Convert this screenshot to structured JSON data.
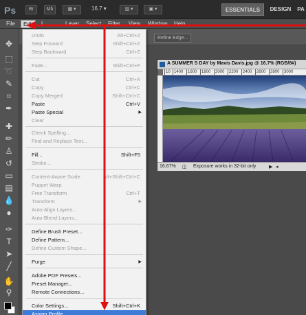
{
  "app": {
    "logo": "Ps",
    "bridge_button": "Br",
    "minibridge_button": "Mb",
    "zoom_level": "16.7",
    "workspaces": [
      "ESSENTIALS",
      "DESIGN",
      "PA"
    ]
  },
  "menubar": {
    "items": [
      "File",
      "Edit",
      "I",
      "Layer",
      "Select",
      "Filter",
      "View",
      "Window",
      "Help"
    ]
  },
  "options": {
    "refine_edge": "Refine Edge..."
  },
  "document": {
    "title": "A SUMMER S DAY by Mavis Davis.jpg @ 16.7% (RGB/8#)",
    "ruler_ticks": [
      "10",
      "1400",
      "1600",
      "1800",
      "2000",
      "2200",
      "2400",
      "2600",
      "2800",
      "3000"
    ],
    "status_zoom": "16.67%",
    "status_text": "Exposure works in 32-bit only"
  },
  "edit_menu": {
    "items": [
      {
        "label": "Undo",
        "shortcut": "Alt+Ctrl+Z",
        "disabled": true
      },
      {
        "label": "Step Forward",
        "shortcut": "Shift+Ctrl+Z",
        "disabled": true
      },
      {
        "label": "Step Backward",
        "shortcut": "Ctrl+Z",
        "disabled": true
      },
      {
        "label": "Fade...",
        "shortcut": "Shift+Ctrl+F",
        "disabled": true
      },
      {
        "label": "Cut",
        "shortcut": "Ctrl+X",
        "disabled": true
      },
      {
        "label": "Copy",
        "shortcut": "Ctrl+C",
        "disabled": true
      },
      {
        "label": "Copy Merged",
        "shortcut": "Shift+Ctrl+C",
        "disabled": true
      },
      {
        "label": "Paste",
        "shortcut": "Ctrl+V",
        "disabled": false
      },
      {
        "label": "Paste Special",
        "shortcut": "",
        "disabled": false,
        "submenu": true
      },
      {
        "label": "Clear",
        "shortcut": "",
        "disabled": true
      },
      {
        "label": "Check Spelling...",
        "shortcut": "",
        "disabled": true
      },
      {
        "label": "Find and Replace Text...",
        "shortcut": "",
        "disabled": true
      },
      {
        "label": "Fill...",
        "shortcut": "Shift+F5",
        "disabled": false
      },
      {
        "label": "Stroke...",
        "shortcut": "",
        "disabled": true
      },
      {
        "label": "Content-Aware Scale",
        "shortcut": "Alt+Shift+Ctrl+C",
        "disabled": true
      },
      {
        "label": "Puppet Warp",
        "shortcut": "",
        "disabled": true
      },
      {
        "label": "Free Transform",
        "shortcut": "Ctrl+T",
        "disabled": true
      },
      {
        "label": "Transform",
        "shortcut": "",
        "disabled": true,
        "submenu": true
      },
      {
        "label": "Auto-Align Layers...",
        "shortcut": "",
        "disabled": true
      },
      {
        "label": "Auto-Blend Layers...",
        "shortcut": "",
        "disabled": true
      },
      {
        "label": "Define Brush Preset...",
        "shortcut": "",
        "disabled": false
      },
      {
        "label": "Define Pattern...",
        "shortcut": "",
        "disabled": false
      },
      {
        "label": "Define Custom Shape...",
        "shortcut": "",
        "disabled": true
      },
      {
        "label": "Purge",
        "shortcut": "",
        "disabled": false,
        "submenu": true
      },
      {
        "label": "Adobe PDF Presets...",
        "shortcut": "",
        "disabled": false
      },
      {
        "label": "Preset Manager...",
        "shortcut": "",
        "disabled": false
      },
      {
        "label": "Remote Connections...",
        "shortcut": "",
        "disabled": false
      },
      {
        "label": "Color Settings...",
        "shortcut": "Shift+Ctrl+K",
        "disabled": false
      },
      {
        "label": "Assign Profile...",
        "shortcut": "",
        "disabled": false,
        "selected": true
      }
    ]
  },
  "colors": {
    "selection": "#3d7bd8",
    "annotation": "#e01010"
  }
}
